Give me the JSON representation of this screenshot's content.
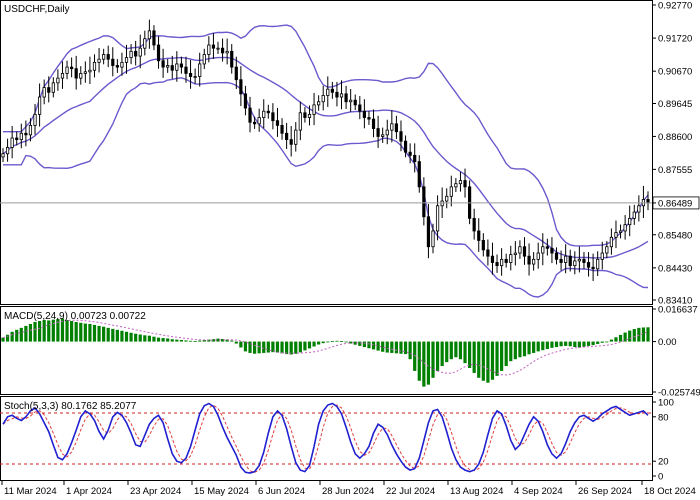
{
  "window": {
    "title": "USDCHF,Daily",
    "current_price": "0.86489"
  },
  "chart_data": [
    {
      "type": "candlestick",
      "symbol": "USDCHF",
      "timeframe": "Daily",
      "indicator": "Bollinger Bands",
      "ylim": [
        0.8341,
        0.9277
      ],
      "price_ticks": [
        "0.92770",
        "0.91720",
        "0.90670",
        "0.89645",
        "0.88600",
        "0.87555",
        "0.86489",
        "0.85480",
        "0.84430",
        "0.83410"
      ],
      "x_ticks": [
        "11 Mar 2024",
        "1 Apr 2024",
        "23 Apr 2024",
        "15 May 2024",
        "6 Jun 2024",
        "28 Jun 2024",
        "22 Jul 2024",
        "13 Aug 2024",
        "4 Sep 2024",
        "26 Sep 2024",
        "18 Oct 2024"
      ],
      "close": [
        0.8805,
        0.8825,
        0.8855,
        0.885,
        0.887,
        0.8865,
        0.8895,
        0.893,
        0.8985,
        0.9015,
        0.9,
        0.903,
        0.9045,
        0.906,
        0.908,
        0.9075,
        0.9045,
        0.906,
        0.9065,
        0.907,
        0.9095,
        0.9105,
        0.912,
        0.9105,
        0.9085,
        0.908,
        0.9095,
        0.911,
        0.913,
        0.9115,
        0.914,
        0.917,
        0.9195,
        0.915,
        0.91,
        0.908,
        0.9085,
        0.907,
        0.909,
        0.908,
        0.906,
        0.905,
        0.905,
        0.909,
        0.912,
        0.915,
        0.914,
        0.914,
        0.9125,
        0.913,
        0.908,
        0.904,
        0.8995,
        0.895,
        0.8905,
        0.89,
        0.892,
        0.894,
        0.8935,
        0.891,
        0.8895,
        0.887,
        0.885,
        0.8835,
        0.888,
        0.8935,
        0.892,
        0.893,
        0.896,
        0.897,
        0.899,
        0.901,
        0.9,
        0.8985,
        0.8995,
        0.897,
        0.8975,
        0.896,
        0.894,
        0.892,
        0.8915,
        0.8885,
        0.886,
        0.8865,
        0.888,
        0.89,
        0.8875,
        0.8845,
        0.881,
        0.88,
        0.878,
        0.87,
        0.8605,
        0.851,
        0.856,
        0.864,
        0.8655,
        0.867,
        0.87,
        0.871,
        0.872,
        0.87,
        0.86,
        0.856,
        0.853,
        0.85,
        0.848,
        0.846,
        0.845,
        0.847,
        0.846,
        0.8485,
        0.849,
        0.851,
        0.848,
        0.8455,
        0.847,
        0.849,
        0.851,
        0.8505,
        0.849,
        0.847,
        0.846,
        0.848,
        0.845,
        0.8465,
        0.847,
        0.846,
        0.8445,
        0.844,
        0.847,
        0.849,
        0.851,
        0.854,
        0.8555,
        0.856,
        0.858,
        0.86,
        0.862,
        0.864,
        0.866,
        0.8649
      ],
      "bands": {
        "upper_start": 0.8875,
        "lower_start": 0.877,
        "upper_end": 0.8674,
        "middle_end": 0.858,
        "lower_end": 0.849
      }
    },
    {
      "type": "histogram",
      "indicator": "MACD",
      "label": "MACD(5,24,9) 0.00723 0.00722",
      "ticks": [
        "0.016637",
        "0.00",
        "-0.025749"
      ],
      "ylim": [
        -0.025749,
        0.016637
      ],
      "values": [
        0.002,
        0.0035,
        0.005,
        0.006,
        0.007,
        0.008,
        0.009,
        0.01,
        0.0105,
        0.011,
        0.0108,
        0.0112,
        0.0115,
        0.0118,
        0.011,
        0.0105,
        0.01,
        0.0096,
        0.0092,
        0.009,
        0.0085,
        0.008,
        0.0076,
        0.007,
        0.0065,
        0.006,
        0.0055,
        0.005,
        0.0045,
        0.004,
        0.0036,
        0.0032,
        0.003,
        0.0025,
        0.002,
        0.0018,
        0.0016,
        0.0012,
        0.001,
        0.0008,
        0.0006,
        0.0004,
        0.0003,
        0.0005,
        0.0008,
        0.001,
        0.0012,
        0.0015,
        0.0013,
        0.001,
        0.0005,
        -0.001,
        -0.003,
        -0.005,
        -0.0058,
        -0.0062,
        -0.006,
        -0.0058,
        -0.0056,
        -0.0054,
        -0.0056,
        -0.006,
        -0.0064,
        -0.0066,
        -0.0062,
        -0.0055,
        -0.0045,
        -0.0035,
        -0.0025,
        -0.0015,
        -0.0008,
        -0.0003,
        0.0002,
        0.0004,
        0.0002,
        -0.0004,
        -0.001,
        -0.0016,
        -0.0022,
        -0.0028,
        -0.0034,
        -0.004,
        -0.0046,
        -0.0052,
        -0.0056,
        -0.0058,
        -0.006,
        -0.0062,
        -0.0064,
        -0.009,
        -0.015,
        -0.02,
        -0.023,
        -0.022,
        -0.0185,
        -0.015,
        -0.0125,
        -0.0105,
        -0.009,
        -0.008,
        -0.009,
        -0.011,
        -0.0135,
        -0.016,
        -0.0185,
        -0.02,
        -0.021,
        -0.0195,
        -0.0175,
        -0.015,
        -0.0125,
        -0.01,
        -0.009,
        -0.008,
        -0.0075,
        -0.0065,
        -0.0058,
        -0.005,
        -0.0044,
        -0.0038,
        -0.0032,
        -0.0028,
        -0.0024,
        -0.0022,
        -0.0024,
        -0.0028,
        -0.003,
        -0.0026,
        -0.0022,
        -0.0018,
        -0.0012,
        -0.0006,
        0.0,
        0.001,
        0.0022,
        0.0034,
        0.0046,
        0.0056,
        0.0064,
        0.007,
        0.0072,
        0.0073
      ]
    },
    {
      "type": "line",
      "indicator": "Stochastic",
      "label": "Stoch(5,3,3) 80.1762 85.2077",
      "ticks": [
        "100",
        "80",
        "20",
        "0"
      ],
      "ylim": [
        0,
        100
      ],
      "levels": [
        80,
        20
      ],
      "values": [
        70,
        80,
        82,
        78,
        75,
        80,
        88,
        92,
        84,
        72,
        60,
        42,
        25,
        22,
        30,
        45,
        62,
        80,
        88,
        84,
        75,
        60,
        50,
        62,
        80,
        86,
        82,
        72,
        58,
        42,
        40,
        55,
        70,
        78,
        82,
        72,
        50,
        30,
        20,
        18,
        24,
        40,
        62,
        84,
        95,
        98,
        94,
        82,
        66,
        52,
        40,
        28,
        12,
        5,
        4,
        6,
        14,
        32,
        58,
        80,
        88,
        82,
        64,
        40,
        18,
        8,
        6,
        14,
        40,
        70,
        88,
        96,
        98,
        94,
        84,
        66,
        46,
        30,
        24,
        30,
        40,
        58,
        70,
        66,
        56,
        42,
        30,
        20,
        12,
        8,
        10,
        24,
        48,
        72,
        88,
        90,
        80,
        60,
        38,
        22,
        12,
        8,
        6,
        8,
        16,
        32,
        56,
        78,
        88,
        84,
        68,
        48,
        36,
        42,
        56,
        70,
        80,
        74,
        60,
        42,
        30,
        24,
        30,
        44,
        60,
        72,
        80,
        82,
        78,
        74,
        78,
        84,
        88,
        92,
        94,
        90,
        86,
        82,
        84,
        86,
        88,
        82
      ]
    }
  ]
}
